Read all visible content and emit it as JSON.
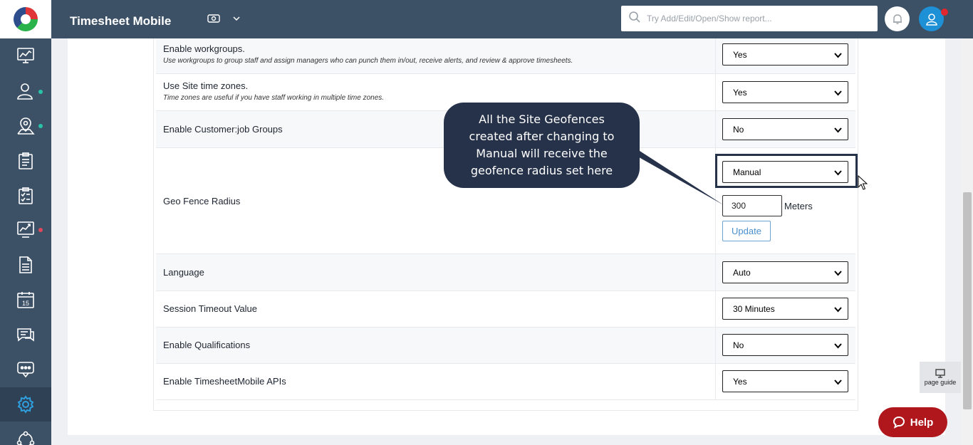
{
  "header": {
    "app_title": "Timesheet Mobile",
    "search_placeholder": "Try Add/Edit/Open/Show report..."
  },
  "sidebar": {
    "items": [
      {
        "name": "dashboard",
        "icon": "chart-screen-icon"
      },
      {
        "name": "staff",
        "icon": "users-icon",
        "dot": "#27c4a8"
      },
      {
        "name": "sites",
        "icon": "map-pin-icon",
        "dot": "#27c4a8"
      },
      {
        "name": "jobs",
        "icon": "clipboard-list-icon"
      },
      {
        "name": "timesheets",
        "icon": "checklist-icon"
      },
      {
        "name": "reports",
        "icon": "trend-chart-icon",
        "dot": "#e0485c"
      },
      {
        "name": "documents",
        "icon": "document-icon"
      },
      {
        "name": "schedule",
        "icon": "calendar-icon",
        "day": "15"
      },
      {
        "name": "messages",
        "icon": "chat-icon"
      },
      {
        "name": "sms",
        "icon": "message-dots-icon"
      },
      {
        "name": "settings",
        "icon": "gear-icon",
        "active": true
      },
      {
        "name": "integrations",
        "icon": "share-icon"
      }
    ]
  },
  "settings": {
    "workgroups": {
      "label": "Enable workgroups.",
      "desc": "Use workgroups to group staff and assign managers who can punch them in/out, receive alerts, and review & approve timesheets.",
      "value": "Yes"
    },
    "site_timezones": {
      "label": "Use Site time zones.",
      "desc": "Time zones are useful if you have staff working in multiple time zones.",
      "value": "Yes"
    },
    "customer_job_groups": {
      "label": "Enable Customer:job Groups",
      "value": "No"
    },
    "geofence": {
      "label": "Geo Fence Radius",
      "mode": "Manual",
      "radius": "300",
      "unit": "Meters",
      "update_label": "Update"
    },
    "language": {
      "label": "Language",
      "value": "Auto"
    },
    "session_timeout": {
      "label": "Session Timeout Value",
      "value": "30 Minutes"
    },
    "qualifications": {
      "label": "Enable Qualifications",
      "value": "No"
    },
    "api": {
      "label": "Enable TimesheetMobile APIs",
      "value": "Yes"
    }
  },
  "tooltip": {
    "line1": "All the Site Geofences",
    "line2": "created after changing to",
    "line3": "Manual will receive the",
    "line4": "geofence radius set here"
  },
  "widgets": {
    "page_guide_label": "page guide",
    "help_label": "Help"
  },
  "colors": {
    "nav_bg": "#3d5166",
    "tooltip_bg": "#26324a",
    "help_red": "#b0171c",
    "accent_blue": "#1e90d6"
  }
}
